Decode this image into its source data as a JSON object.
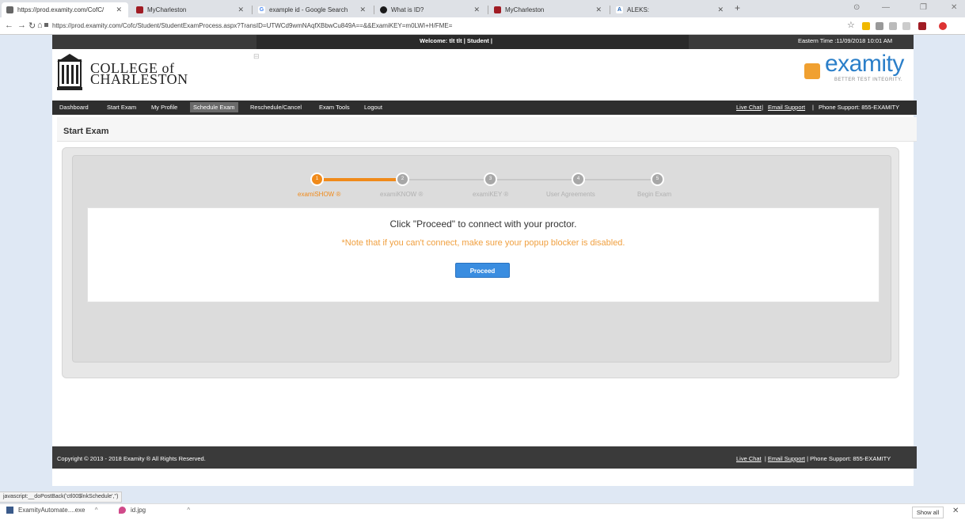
{
  "browser": {
    "tabs": [
      {
        "title": "https://prod.examity.com/CofC/",
        "favicon": "lock-favicon",
        "active": true
      },
      {
        "title": "MyCharleston",
        "favicon": "charleston-favicon"
      },
      {
        "title": "example id - Google Search",
        "favicon": "google-favicon"
      },
      {
        "title": "What is ID?",
        "favicon": "quora-favicon"
      },
      {
        "title": "MyCharleston",
        "favicon": "charleston-favicon"
      },
      {
        "title": "ALEKS:",
        "favicon": "aleks-favicon"
      }
    ],
    "url": "https://prod.examity.com/Cofc/Student/StudentExamProcess.aspx?TransID=UTWCd9wmNAqfXBbwCu849A==&&ExamiKEY=m0LWI+H/FME="
  },
  "header": {
    "welcome": "Welcome: tlt tlt | Student |",
    "eastern_time": "Eastern Time :11/09/2018 10:01 AM",
    "college_line1": "COLLEGE of",
    "college_line2": "CHARLESTON",
    "examity_name": "examity",
    "examity_tagline": "BETTER TEST INTEGRITY."
  },
  "nav": {
    "items": [
      "Dashboard",
      "Start Exam",
      "My Profile",
      "Schedule Exam",
      "Reschedule/Cancel",
      "Exam Tools",
      "Logout"
    ],
    "selected": "Schedule Exam",
    "live_chat": "Live Chat",
    "email_support": "Email Support",
    "phone_support": "Phone Support: 855-EXAMITY"
  },
  "content": {
    "title": "Start Exam",
    "steps": [
      {
        "number": "1",
        "label": "examiSHOW ®",
        "active": true
      },
      {
        "number": "2",
        "label": "examiKNOW ®",
        "active": false
      },
      {
        "number": "3",
        "label": "examiKEY ®",
        "active": false
      },
      {
        "number": "4",
        "label": "User Agreements",
        "active": false
      },
      {
        "number": "5",
        "label": "Begin Exam",
        "active": false
      }
    ],
    "message": "Click \"Proceed\" to connect with your proctor.",
    "note": "*Note that if you can't connect, make sure your popup blocker is disabled.",
    "proceed_label": "Proceed"
  },
  "footer": {
    "copyright": "Copyright © 2013 - 2018 Examity ® All Rights Reserved.",
    "live_chat": "Live Chat",
    "email_support": "Email Support",
    "phone_support": "Phone Support: 855-EXAMITY"
  },
  "status_bar": "javascript:__doPostBack('ctl00$lnkSchedule','')",
  "downloads": {
    "items": [
      "ExamityAutomate....exe",
      "id.jpg"
    ],
    "show_all": "Show all"
  },
  "colors": {
    "accent_orange": "#f08a1a",
    "button_blue": "#3a8de0",
    "nav_dark": "#2e2e2e",
    "examity_blue": "#2b7fc9"
  }
}
